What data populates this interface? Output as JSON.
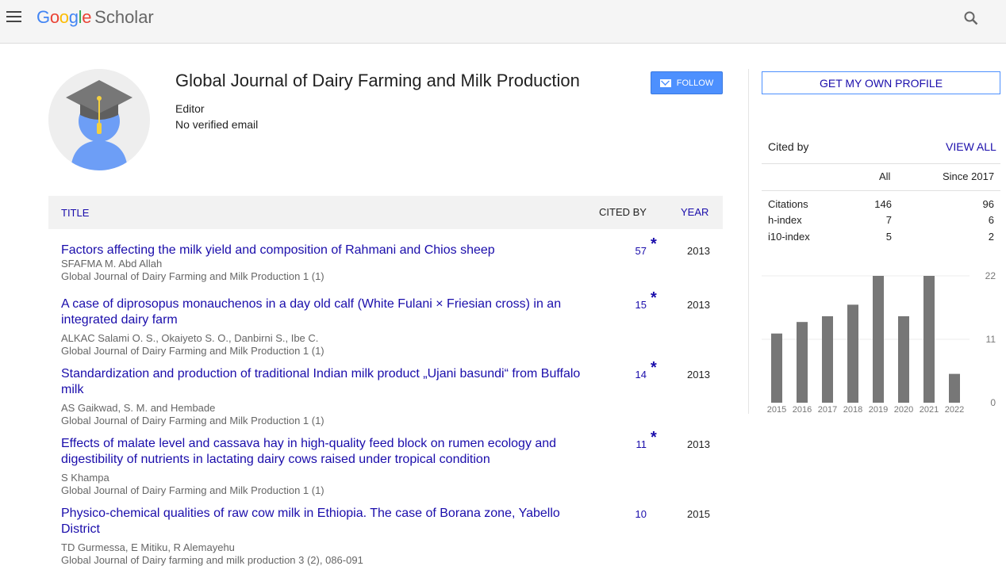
{
  "header": {
    "logo_google": "Google",
    "logo_scholar": "Scholar",
    "icons": [
      "menu-icon",
      "search-icon"
    ]
  },
  "profile": {
    "name": "Global Journal of Dairy Farming and Milk Production",
    "role": "Editor",
    "email": "No verified email",
    "follow_label": "FOLLOW",
    "avatar_icon": "graduation-cap-avatar-icon"
  },
  "table": {
    "col_title": "TITLE",
    "col_cited": "CITED BY",
    "col_year": "YEAR"
  },
  "articles": [
    {
      "title": "Factors affecting the milk yield and composition of Rahmani and Chios sheep",
      "authors": "SFAFMA M. Abd Allah",
      "venue": "Global Journal of Dairy Farming and Milk Production 1 (1)",
      "cited": "57",
      "star": "*",
      "year": "2013"
    },
    {
      "title": "A case of diprosopus monauchenos in a day old calf (White Fulani × Friesian cross) in an integrated dairy farm",
      "authors": "ALKAC Salami O. S., Okaiyeto S. O., Danbirni S., Ibe C.",
      "venue": "Global Journal of Dairy Farming and Milk Production 1 (1)",
      "cited": "15",
      "star": "*",
      "year": "2013"
    },
    {
      "title": "Standardization and production of traditional Indian milk product „Ujani basundi“ from Buffalo milk",
      "authors": "AS Gaikwad, S. M. and Hembade",
      "venue": "Global Journal of Dairy Farming and Milk Production 1 (1)",
      "cited": "14",
      "star": "*",
      "year": "2013"
    },
    {
      "title": "Effects of malate level and cassava hay in high-quality feed block on rumen ecology and digestibility of nutrients in lactating dairy cows raised under tropical condition",
      "authors": "S Khampa",
      "venue": "Global Journal of Dairy Farming and Milk Production 1 (1)",
      "cited": "11",
      "star": "*",
      "year": "2013"
    },
    {
      "title": "Physico-chemical qualities of raw cow milk in Ethiopia. The case of Borana zone, Yabello District",
      "authors": "TD Gurmessa, E Mitiku, R Alemayehu",
      "venue": "Global Journal of Dairy farming and milk production 3 (2), 086-091",
      "cited": "10",
      "star": "",
      "year": "2015"
    }
  ],
  "sidebar": {
    "own_profile_label": "GET MY OWN PROFILE",
    "cited_by_title": "Cited by",
    "view_all_label": "VIEW ALL",
    "col_all": "All",
    "col_since": "Since 2017",
    "stats": [
      {
        "label": "Citations",
        "all": "146",
        "since": "96"
      },
      {
        "label": "h-index",
        "all": "7",
        "since": "6"
      },
      {
        "label": "i10-index",
        "all": "5",
        "since": "2"
      }
    ]
  },
  "chart_data": {
    "type": "bar",
    "categories": [
      "2015",
      "2016",
      "2017",
      "2018",
      "2019",
      "2020",
      "2021",
      "2022"
    ],
    "values": [
      12,
      14,
      15,
      17,
      22,
      15,
      22,
      5
    ],
    "ylim": [
      0,
      22
    ],
    "yticks": [
      "0",
      "11",
      "22"
    ],
    "bar_color": "#777777",
    "grid": true
  }
}
